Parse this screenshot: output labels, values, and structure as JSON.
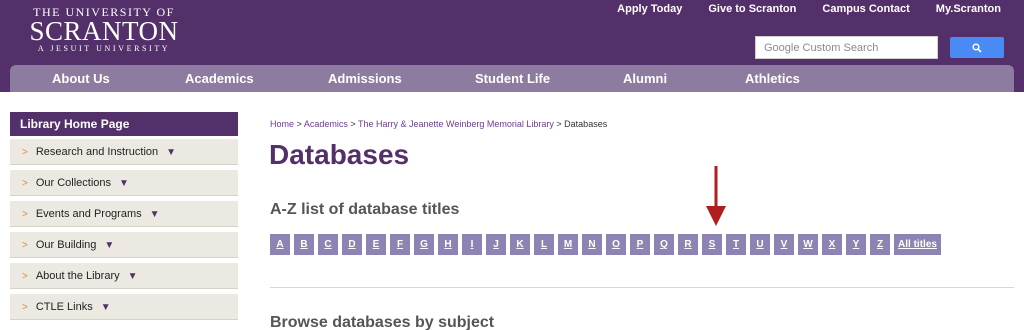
{
  "logo": {
    "line1": "THE UNIVERSITY OF",
    "line2": "SCRANTON",
    "line3": "A JESUIT UNIVERSITY"
  },
  "toplinks": [
    "Apply Today",
    "Give to Scranton",
    "Campus Contact",
    "My.Scranton"
  ],
  "search": {
    "placeholder": "Google Custom Search",
    "button_icon": "search-icon"
  },
  "nav": [
    "About Us",
    "Academics",
    "Admissions",
    "Student Life",
    "Alumni",
    "Athletics"
  ],
  "sidebar": {
    "heading": "Library Home Page",
    "items": [
      "Research and Instruction",
      "Our Collections",
      "Events and Programs",
      "Our Building",
      "About the Library",
      "CTLE Links"
    ]
  },
  "breadcrumb": {
    "items": [
      "Home",
      "Academics",
      "The Harry & Jeanette Weinberg Memorial Library"
    ],
    "current": "Databases",
    "separator": ">"
  },
  "page_title": "Databases",
  "az_heading": "A-Z list of database titles",
  "letters": [
    "A",
    "B",
    "C",
    "D",
    "E",
    "F",
    "G",
    "H",
    "I",
    "J",
    "K",
    "L",
    "M",
    "N",
    "O",
    "P",
    "Q",
    "R",
    "S",
    "T",
    "U",
    "V",
    "W",
    "X",
    "Y",
    "Z"
  ],
  "all_titles": "All titles",
  "browse_heading": "Browse databases by subject",
  "colors": {
    "brand_purple": "#54306b",
    "nav_purple": "#8e7ca0",
    "letter_button": "#8e84b4",
    "annotation_arrow": "#b01e1e"
  }
}
